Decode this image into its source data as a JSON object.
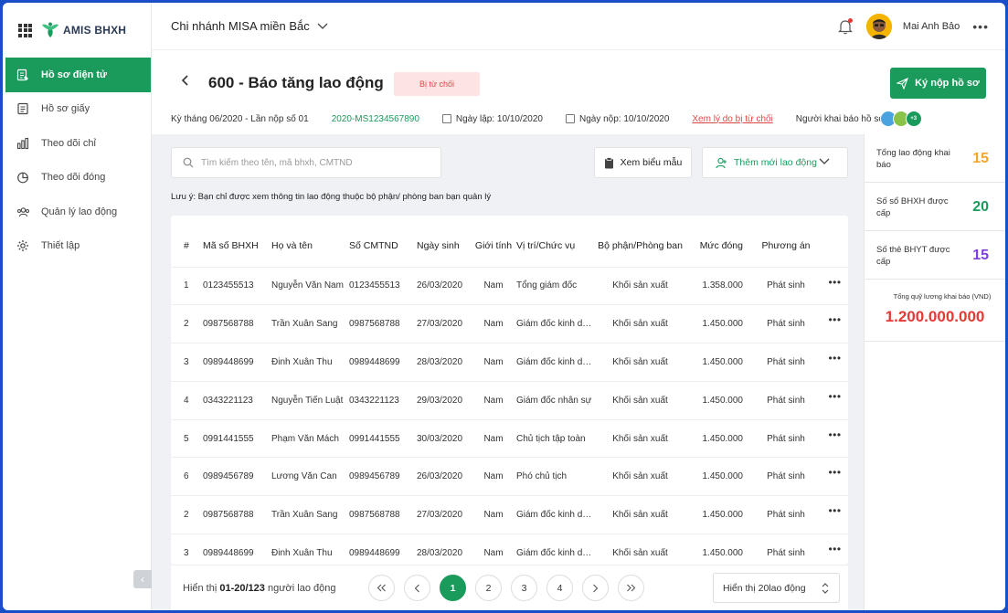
{
  "app": {
    "name": "AMIS BHXH"
  },
  "sidebar": {
    "items": [
      {
        "label": "Hồ sơ điện tử",
        "icon": "document-icon",
        "active": true
      },
      {
        "label": "Hồ sơ giấy",
        "icon": "paper-file-icon"
      },
      {
        "label": "Theo dõi chỉ",
        "icon": "bar-chart-icon"
      },
      {
        "label": "Theo dõi đóng",
        "icon": "pie-chart-icon"
      },
      {
        "label": "Quản lý lao động",
        "icon": "users-icon"
      },
      {
        "label": "Thiết lập",
        "icon": "gear-icon"
      }
    ]
  },
  "topbar": {
    "branch": "Chi nhánh MISA miền Bắc",
    "user_name": "Mai Anh Bảo"
  },
  "header": {
    "title": "600 - Báo tăng lao động",
    "status": "Bị từ chối",
    "submit_label": "Ký nộp hồ sơ",
    "meta": {
      "period": "Kỳ tháng 06/2020 - Lần nộp số 01",
      "code": "2020-MS1234567890",
      "created": "Ngày lập: 10/10/2020",
      "submitted": "Ngày nộp: 10/10/2020",
      "reject_link": "Xem lý do bị từ chối",
      "submitters_label": "Người khai báo hồ sơ:",
      "more_count": "+3"
    }
  },
  "toolbar": {
    "search_placeholder": "Tìm kiếm theo tên, mã bhxh, CMTND",
    "view_form": "Xem biểu mẫu",
    "add_worker": "Thêm mới lao động",
    "note": "Lưu ý: Bạn chỉ được xem thông tin lao động thuộc bộ phận/ phòng ban bạn quản lý"
  },
  "table": {
    "columns": [
      "#",
      "Mã số BHXH",
      "Họ và tên",
      "Số CMTND",
      "Ngày sinh",
      "Giới tính",
      "Vị trí/Chức vụ",
      "Bộ phận/Phòng ban",
      "Mức đóng",
      "Phương án"
    ],
    "rows": [
      [
        "1",
        "0123455513",
        "Nguyễn Văn Nam",
        "0123455513",
        "26/03/2020",
        "Nam",
        "Tổng giám đốc",
        "Khối sản xuất",
        "1.358.000",
        "Phát sinh"
      ],
      [
        "2",
        "0987568788",
        "Trần Xuân Sang",
        "0987568788",
        "27/03/2020",
        "Nam",
        "Giám đốc kinh doanh",
        "Khối sản xuất",
        "1.450.000",
        "Phát sinh"
      ],
      [
        "3",
        "0989448699",
        "Đinh Xuân Thu",
        "0989448699",
        "28/03/2020",
        "Nam",
        "Giám đốc kinh doanh",
        "Khối sản xuất",
        "1.450.000",
        "Phát sinh"
      ],
      [
        "4",
        "0343221123",
        "Nguyễn Tiến Luật",
        "0343221123",
        "29/03/2020",
        "Nam",
        "Giám đốc nhân sự",
        "Khối sản xuất",
        "1.450.000",
        "Phát sinh"
      ],
      [
        "5",
        "0991441555",
        "Phạm Văn Mách",
        "0991441555",
        "30/03/2020",
        "Nam",
        "Chủ tịch tập toàn",
        "Khối sản xuất",
        "1.450.000",
        "Phát sinh"
      ],
      [
        "6",
        "0989456789",
        "Lương Văn Can",
        "0989456789",
        "26/03/2020",
        "Nam",
        "Phó chủ tịch",
        "Khối sản xuất",
        "1.450.000",
        "Phát sinh"
      ],
      [
        "2",
        "0987568788",
        "Trần Xuân Sang",
        "0987568788",
        "27/03/2020",
        "Nam",
        "Giám đốc kinh doanh",
        "Khối sản xuất",
        "1.450.000",
        "Phát sinh"
      ],
      [
        "3",
        "0989448699",
        "Đinh Xuân Thu",
        "0989448699",
        "28/03/2020",
        "Nam",
        "Giám đốc kinh doanh",
        "Khối sản xuất",
        "1.450.000",
        "Phát sinh"
      ]
    ]
  },
  "pagination": {
    "summary_prefix": "Hiển thị ",
    "summary_range": "01-20/123",
    "summary_suffix": " người lao động",
    "pages": [
      "1",
      "2",
      "3",
      "4"
    ],
    "current": "1",
    "page_size_prefix": "Hiển thị ",
    "page_size_value": "20",
    "page_size_suffix": " lao động"
  },
  "stats": [
    {
      "label": "Tổng lao động khai báo",
      "value": "15",
      "color": "#f5a623"
    },
    {
      "label": "Số sổ BHXH được cấp",
      "value": "20",
      "color": "#1a9b5c"
    },
    {
      "label": "Số thẻ BHYT được cấp",
      "value": "15",
      "color": "#7e3fe0"
    }
  ],
  "total_salary": {
    "label": "Tổng quỹ lương khai báo (VND)",
    "value": "1.200.000.000",
    "color": "#e53935"
  },
  "colors": {
    "primary": "#1a9b5c",
    "danger": "#e53935",
    "badge_bg": "#fde3e3"
  }
}
